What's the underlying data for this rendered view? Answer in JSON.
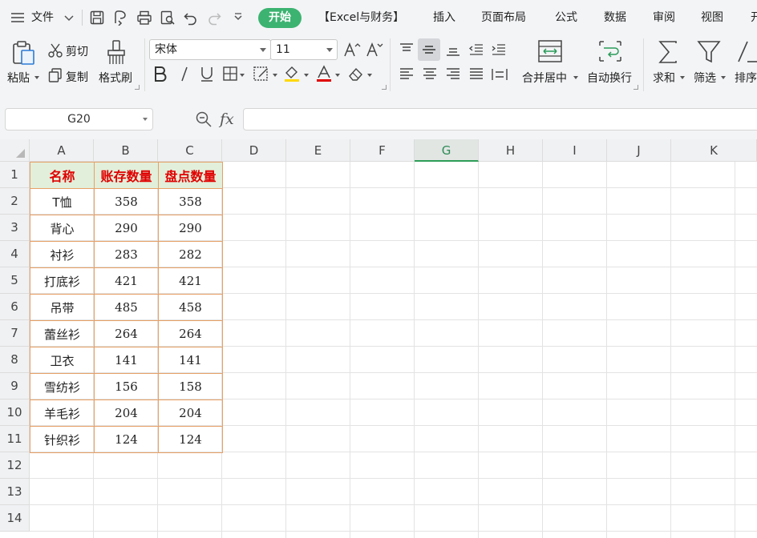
{
  "menu": {
    "file_label": "文件",
    "start_tab": "开始",
    "tabs": [
      "【Excel与财务】",
      "插入",
      "页面布局",
      "公式",
      "数据",
      "审阅",
      "视图",
      "开"
    ]
  },
  "ribbon": {
    "paste": "粘贴",
    "cut": "剪切",
    "copy": "复制",
    "format_painter": "格式刷",
    "font_name": "宋体",
    "font_size": "11",
    "merge_center": "合并居中",
    "wrap_text": "自动换行",
    "sum": "求和",
    "filter": "筛选",
    "sort": "排序"
  },
  "formula_bar": {
    "name_box": "G20",
    "fx": "fx",
    "formula": ""
  },
  "sheet": {
    "columns": [
      "A",
      "B",
      "C",
      "D",
      "E",
      "F",
      "G",
      "H",
      "I",
      "J",
      "K"
    ],
    "selected_column": "G",
    "rows": [
      "1",
      "2",
      "3",
      "4",
      "5",
      "6",
      "7",
      "8",
      "9",
      "10",
      "11",
      "12",
      "13",
      "14"
    ],
    "table_header": [
      "名称",
      "账存数量",
      "盘点数量"
    ],
    "table_rows": [
      [
        "T恤",
        "358",
        "358"
      ],
      [
        "背心",
        "290",
        "290"
      ],
      [
        "衬衫",
        "283",
        "282"
      ],
      [
        "打底衫",
        "421",
        "421"
      ],
      [
        "吊带",
        "485",
        "458"
      ],
      [
        "蕾丝衫",
        "264",
        "264"
      ],
      [
        "卫衣",
        "141",
        "141"
      ],
      [
        "雪纺衫",
        "156",
        "158"
      ],
      [
        "羊毛衫",
        "204",
        "204"
      ],
      [
        "针织衫",
        "124",
        "124"
      ]
    ]
  },
  "colors": {
    "accent_green": "#3cb371",
    "header_fill": "#e2efda",
    "header_text": "#e00000",
    "table_border": "#e7a066"
  }
}
